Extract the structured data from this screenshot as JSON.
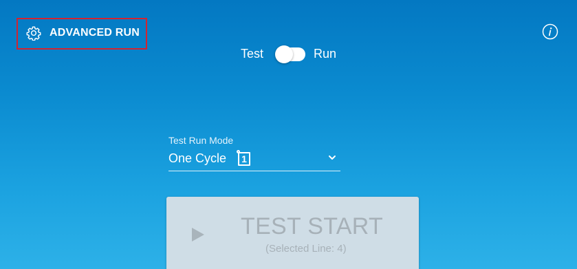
{
  "header": {
    "advanced_run_label": "ADVANCED RUN",
    "advanced_run_icon": "gear-icon",
    "info_icon": "info-icon",
    "highlight_color": "#d4232f"
  },
  "mode_toggle": {
    "left_label": "Test",
    "right_label": "Run",
    "state": "Test"
  },
  "run_mode": {
    "label": "Test Run Mode",
    "selected_value": "One Cycle",
    "cycle_badge": "1"
  },
  "start_button": {
    "label": "TEST START",
    "sub_label": "(Selected Line: 4)",
    "enabled": false
  },
  "colors": {
    "background_top": "#0378c2",
    "background_bottom": "#2db1e8",
    "disabled_button": "#cfdde6"
  }
}
